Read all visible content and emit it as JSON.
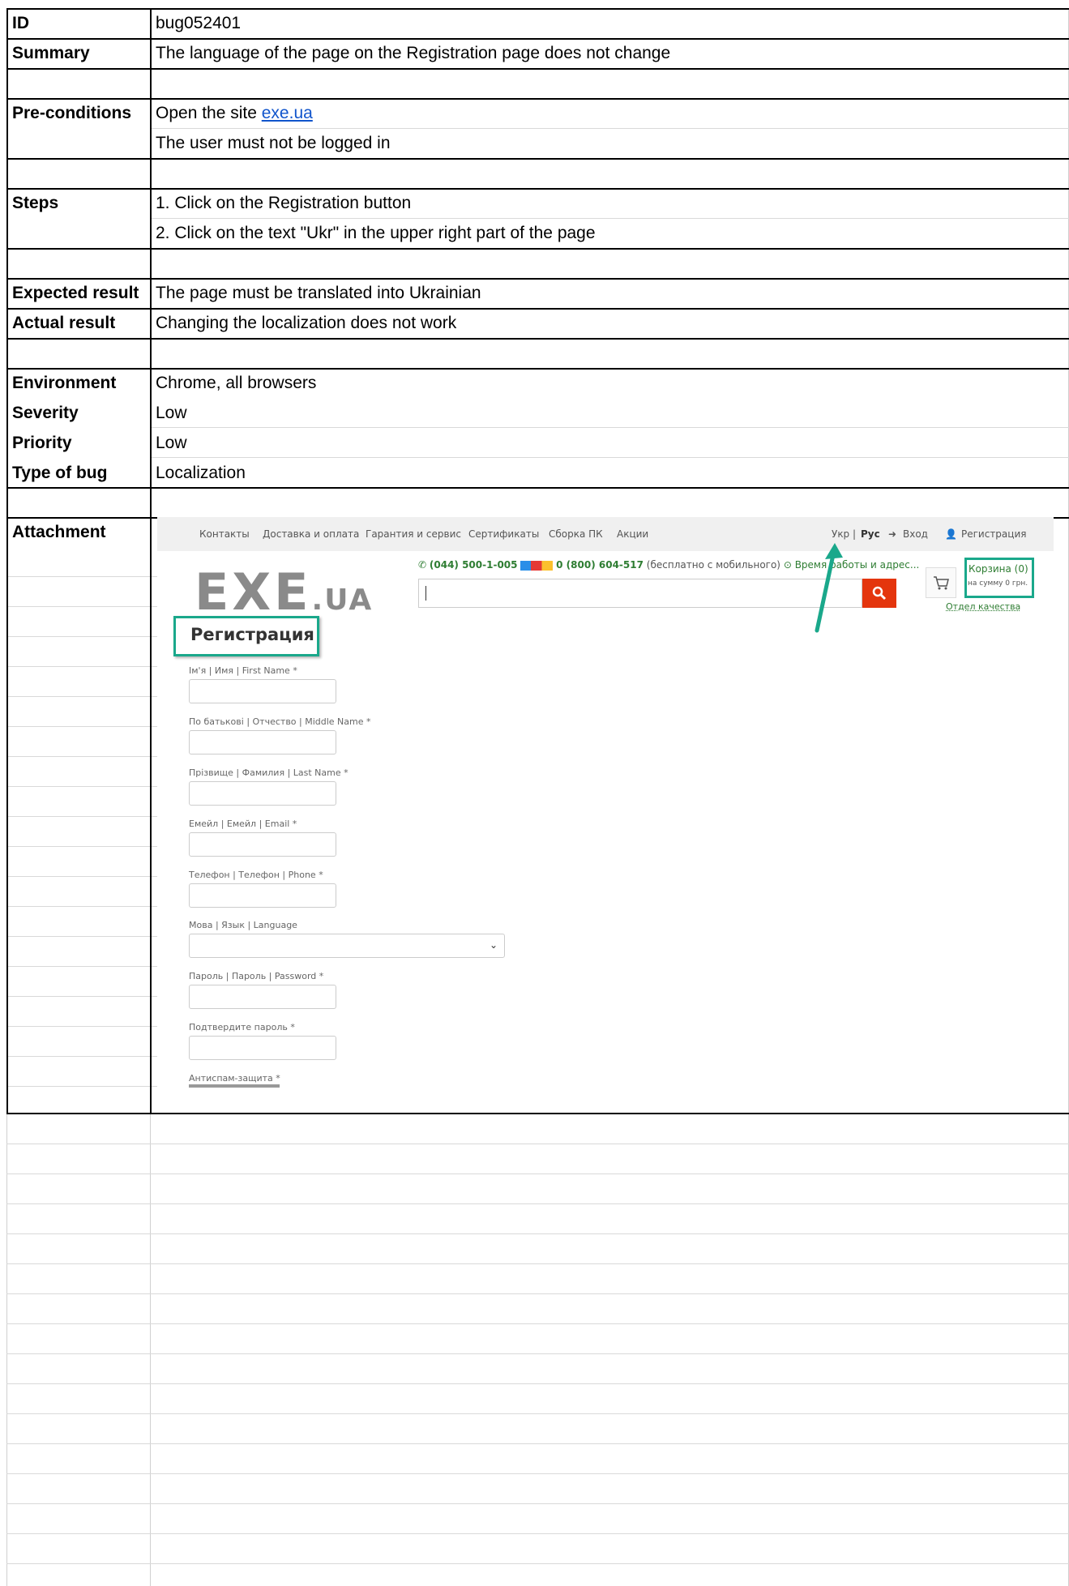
{
  "table": {
    "rows": [
      {
        "label": "ID",
        "value": "bug052401"
      },
      {
        "label": "Summary",
        "value": "The language of the page on the Registration page does not change"
      },
      {
        "label": "",
        "value": ""
      },
      {
        "label": "Pre-conditions",
        "value_prefix": "Open the site ",
        "link": "exe.ua"
      },
      {
        "label": "",
        "value": "The user must not be logged in"
      },
      {
        "label": "",
        "value": ""
      },
      {
        "label": "Steps",
        "value": "1. Click on the Registration button"
      },
      {
        "label": "",
        "value": "2. Click on the text \"Ukr\" in the upper right part of the page"
      },
      {
        "label": "",
        "value": ""
      },
      {
        "label": "Expected result",
        "value": "The page must be translated into Ukrainian"
      },
      {
        "label": "Actual result",
        "value": "Changing the localization does not work"
      },
      {
        "label": "",
        "value": ""
      },
      {
        "label": "Environment",
        "value": "Chrome, all browsers"
      },
      {
        "label": "Severity",
        "value": "Low"
      },
      {
        "label": "Priority",
        "value": "Low"
      },
      {
        "label": "Type of bug",
        "value": "Localization"
      },
      {
        "label": "",
        "value": ""
      },
      {
        "label": "Attachment",
        "value": ""
      }
    ]
  },
  "screenshot": {
    "nav": [
      "Контакты",
      "Доставка и оплата",
      "Гарантия и сервис",
      "Сертификаты",
      "Сборка ПК",
      "Акции"
    ],
    "lang_ukr": "Укр",
    "lang_sep": "|",
    "lang_rus": "Рус",
    "login": "Вход",
    "register": "Регистрация",
    "logo_big": "EXE",
    "logo_small": ".UA",
    "phone1": "(044) 500-1-005",
    "phone2": "0 (800) 604-517",
    "phone_note": "(бесплатно с мобильного)",
    "hours": "Время работы и адрес...",
    "cart_title": "Корзина (0)",
    "cart_sum": "на сумму 0 грн.",
    "quality": "Отдел качества",
    "heading": "Регистрация",
    "fields": [
      "Ім'я | Имя | First Name *",
      "По батькові | Отчество | Middle Name *",
      "Прізвище | Фамилия | Last Name *",
      "Емейл | Емейл | Email *",
      "Телефон | Телефон | Phone *",
      "Мова | Язык | Language",
      "Пароль | Пароль | Password *",
      "Подтвердите пароль *",
      "Антиспам-защита *"
    ],
    "accent_color": "#1aa88b",
    "search_color": "#e4350d"
  }
}
